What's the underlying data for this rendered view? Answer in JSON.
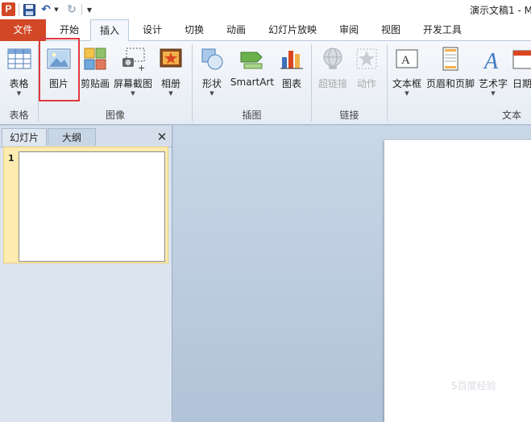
{
  "window": {
    "app_logo": "P",
    "title": "演示文稿1 - M"
  },
  "quick_access": {
    "save_icon": "save-icon",
    "undo_icon": "undo-icon",
    "redo_icon": "redo-icon",
    "customize_icon": "customize-dropdown-icon"
  },
  "tabs": [
    {
      "label": "文件"
    },
    {
      "label": "开始"
    },
    {
      "label": "插入"
    },
    {
      "label": "设计"
    },
    {
      "label": "切换"
    },
    {
      "label": "动画"
    },
    {
      "label": "幻灯片放映"
    },
    {
      "label": "审阅"
    },
    {
      "label": "视图"
    },
    {
      "label": "开发工具"
    }
  ],
  "ribbon": {
    "groups": [
      {
        "label": "表格",
        "buttons": [
          {
            "label": "表格",
            "icon": "table-icon"
          }
        ]
      },
      {
        "label": "图像",
        "buttons": [
          {
            "label": "图片",
            "icon": "picture-icon"
          },
          {
            "label": "剪贴画",
            "icon": "clipart-icon"
          },
          {
            "label": "屏幕截图",
            "icon": "screenshot-icon"
          },
          {
            "label": "相册",
            "icon": "photo-album-icon"
          }
        ]
      },
      {
        "label": "插图",
        "buttons": [
          {
            "label": "形状",
            "icon": "shapes-icon"
          },
          {
            "label": "SmartArt",
            "icon": "smartart-icon"
          },
          {
            "label": "图表",
            "icon": "chart-icon"
          }
        ]
      },
      {
        "label": "链接",
        "buttons": [
          {
            "label": "超链接",
            "icon": "hyperlink-icon"
          },
          {
            "label": "动作",
            "icon": "action-icon"
          }
        ]
      },
      {
        "label": "文本",
        "buttons": [
          {
            "label": "文本框",
            "icon": "textbox-icon"
          },
          {
            "label": "页眉和页脚",
            "icon": "header-footer-icon"
          },
          {
            "label": "艺术字",
            "icon": "wordart-icon"
          },
          {
            "label": "日期",
            "icon": "date-icon"
          }
        ]
      }
    ]
  },
  "left_pane": {
    "tabs": [
      {
        "label": "幻灯片"
      },
      {
        "label": "大纲"
      }
    ],
    "slides": [
      {
        "number": "1"
      }
    ]
  },
  "watermark": "S百度经验"
}
